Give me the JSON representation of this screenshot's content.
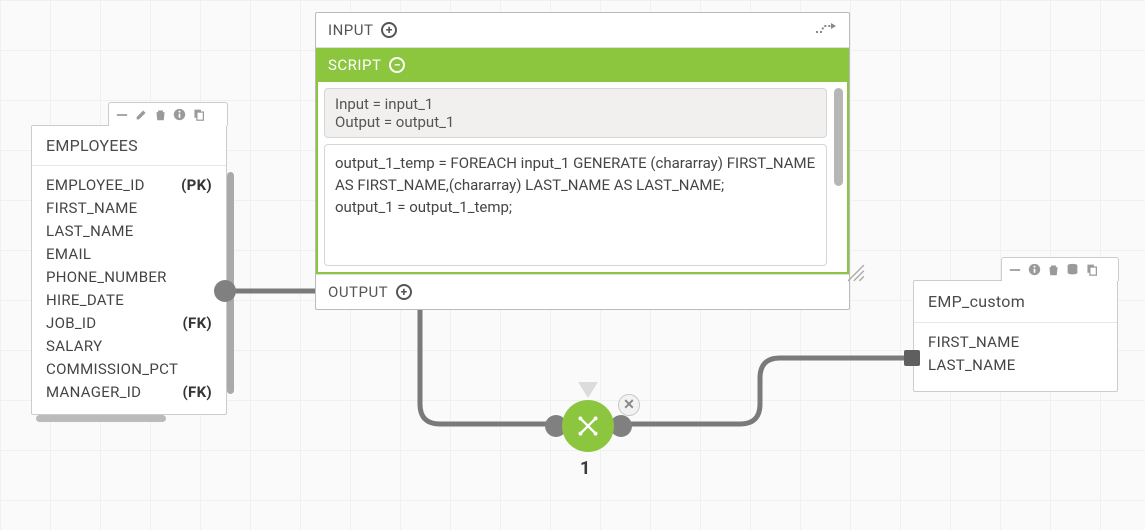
{
  "employees": {
    "title": "EMPLOYEES",
    "columns": [
      {
        "name": "EMPLOYEE_ID",
        "key": "(PK)"
      },
      {
        "name": "FIRST_NAME",
        "key": ""
      },
      {
        "name": "LAST_NAME",
        "key": ""
      },
      {
        "name": "EMAIL",
        "key": ""
      },
      {
        "name": "PHONE_NUMBER",
        "key": ""
      },
      {
        "name": "HIRE_DATE",
        "key": ""
      },
      {
        "name": "JOB_ID",
        "key": "(FK)"
      },
      {
        "name": "SALARY",
        "key": ""
      },
      {
        "name": "COMMISSION_PCT",
        "key": ""
      },
      {
        "name": "MANAGER_ID",
        "key": "(FK)"
      }
    ]
  },
  "transform": {
    "input_label": "INPUT",
    "script_label": "SCRIPT",
    "output_label": "OUTPUT",
    "io_block": "Input = input_1\nOutput = output_1",
    "code_block": "output_1_temp = FOREACH input_1 GENERATE (chararray) FIRST_NAME AS FIRST_NAME,(chararray) LAST_NAME AS LAST_NAME;\noutput_1 = output_1_temp;"
  },
  "node": {
    "label": "1"
  },
  "emp_custom": {
    "title": "EMP_custom",
    "columns": [
      {
        "name": "FIRST_NAME"
      },
      {
        "name": "LAST_NAME"
      }
    ]
  },
  "icons": {
    "minimize": "minimize-icon",
    "edit": "edit-icon",
    "trash": "trash-icon",
    "info": "info-icon",
    "copy": "copy-icon",
    "database": "database-icon"
  },
  "colors": {
    "accent": "#8cc63f"
  }
}
